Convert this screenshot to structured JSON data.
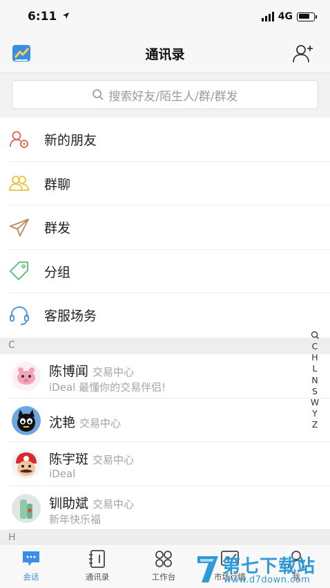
{
  "status_bar": {
    "time": "6:11",
    "network": "4G"
  },
  "nav": {
    "title": "通讯录"
  },
  "search": {
    "placeholder": "搜索好友/陌生人/群/群发"
  },
  "menu": [
    {
      "label": "新的朋友",
      "icon": "new-friend-icon",
      "color": "#e0604a"
    },
    {
      "label": "群聊",
      "icon": "group-chat-icon",
      "color": "#e6c23a"
    },
    {
      "label": "群发",
      "icon": "broadcast-icon",
      "color": "#b8865a"
    },
    {
      "label": "分组",
      "icon": "tag-icon",
      "color": "#4fbf6a"
    },
    {
      "label": "客服场务",
      "icon": "headset-icon",
      "color": "#3a8ee6"
    }
  ],
  "sections": [
    {
      "letter": "C",
      "contacts": [
        {
          "name": "陈博闻",
          "tag": "交易中心",
          "sub": "iDeal 最懂你的交易伴侣!"
        },
        {
          "name": "沈艳",
          "tag": "交易中心",
          "sub": ""
        },
        {
          "name": "陈宇斑",
          "tag": "交易中心",
          "sub": "iDeal"
        },
        {
          "name": "钏助斌",
          "tag": "交易中心",
          "sub": "新年快乐福"
        }
      ]
    },
    {
      "letter": "H",
      "contacts": []
    }
  ],
  "index_letters": [
    "C",
    "H",
    "L",
    "N",
    "S",
    "W",
    "Y",
    "Z"
  ],
  "tabs": [
    {
      "label": "会话",
      "icon": "chat-icon",
      "active": true
    },
    {
      "label": "通讯录",
      "icon": "contacts-book-icon",
      "active": false
    },
    {
      "label": "工作台",
      "icon": "workbench-icon",
      "active": false
    },
    {
      "label": "市场行情",
      "icon": "market-icon",
      "active": false
    },
    {
      "label": "我",
      "icon": "profile-icon",
      "active": false
    }
  ],
  "watermark": {
    "text": "第七下载站",
    "url": "www.d7down.com"
  },
  "colors": {
    "accent": "#3a8ee6",
    "watermark": "#2f9ad8"
  }
}
